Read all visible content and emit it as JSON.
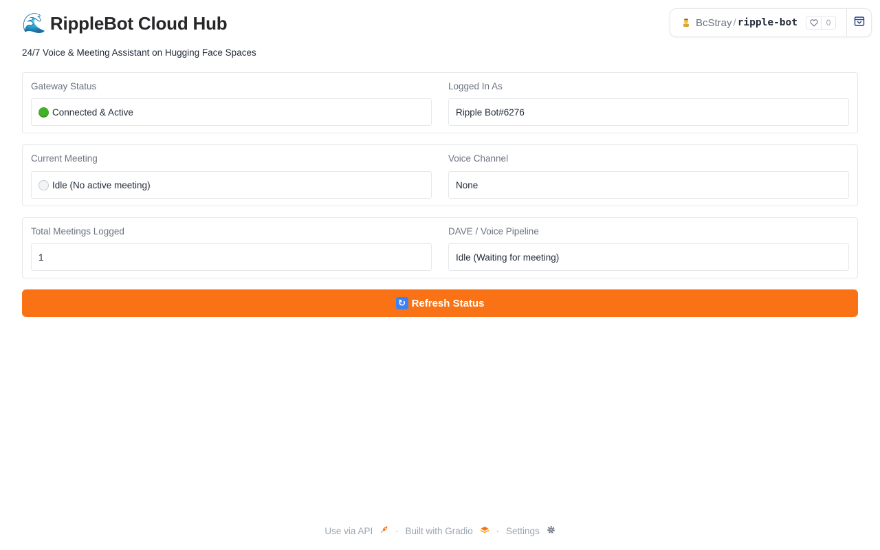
{
  "header": {
    "title": "RippleBot Cloud Hub",
    "title_icon": "wave-icon",
    "subtitle": "24/7 Voice & Meeting Assistant on Hugging Face Spaces"
  },
  "space_badge": {
    "owner": "BcStray",
    "separator": "/",
    "repo": "ripple-bot",
    "likes": "0"
  },
  "status_cards": [
    {
      "left": {
        "label": "Gateway Status",
        "value": "Connected & Active",
        "indicator": "green-circle"
      },
      "right": {
        "label": "Logged In As",
        "value": "Ripple Bot#6276"
      }
    },
    {
      "left": {
        "label": "Current Meeting",
        "value": "Idle (No active meeting)",
        "indicator": "white-circle"
      },
      "right": {
        "label": "Voice Channel",
        "value": "None"
      }
    },
    {
      "left": {
        "label": "Total Meetings Logged",
        "value": "1"
      },
      "right": {
        "label": "DAVE / Voice Pipeline",
        "value": "Idle (Waiting for meeting)"
      }
    }
  ],
  "refresh_button": {
    "label": "Refresh Status",
    "icon": "refresh-icon"
  },
  "footer": {
    "api_label": "Use via API",
    "gradio_label": "Built with Gradio",
    "settings_label": "Settings",
    "dot": "·"
  },
  "colors": {
    "accent": "#f97316",
    "status_green": "#43b02a",
    "border": "#e5e7eb",
    "label": "#6b7280"
  }
}
